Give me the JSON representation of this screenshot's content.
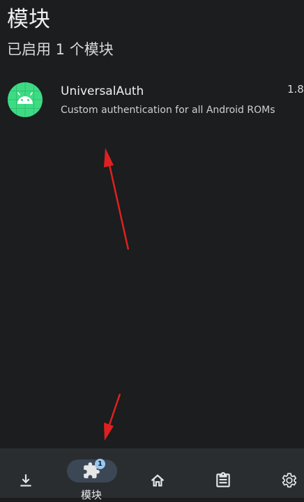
{
  "header": {
    "title": "模块",
    "subtitle": "已启用 1 个模块"
  },
  "modules": [
    {
      "name": "UniversalAuth",
      "version": "1.8",
      "description": "Custom authentication for all Android ROMs",
      "icon": "android-icon"
    }
  ],
  "bottom_nav": {
    "items": [
      {
        "icon": "download-icon"
      },
      {
        "icon": "puzzle-icon",
        "label": "模块",
        "badge": "1",
        "selected": true
      },
      {
        "icon": "home-icon"
      },
      {
        "icon": "clipboard-icon"
      },
      {
        "icon": "gear-icon"
      }
    ]
  },
  "colors": {
    "background": "#1b1d1e",
    "nav_background": "#2a2d30",
    "nav_selected_pill": "#3b4755",
    "badge": "#9cc8ee",
    "module_icon": "#3ddc84",
    "annotation_arrow": "#e02020"
  }
}
